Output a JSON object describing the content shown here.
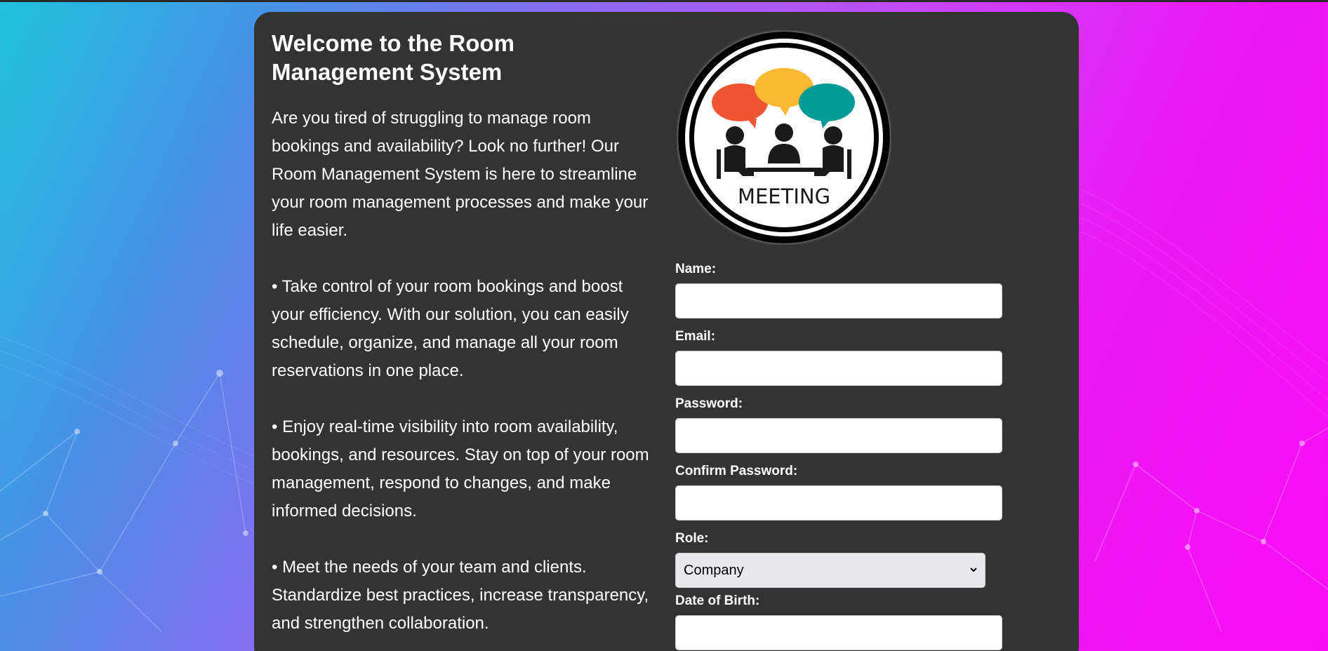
{
  "intro": {
    "title": "Welcome to the Room Management System",
    "paragraphs": [
      "Are you tired of struggling to manage room bookings and availability? Look no further! Our Room Management System is here to streamline your room management processes and make your life easier.",
      "• Take control of your room bookings and boost your efficiency. With our solution, you can easily schedule, organize, and manage all your room reservations in one place.",
      "• Enjoy real-time visibility into room availability, bookings, and resources. Stay on top of your room management, respond to changes, and make informed decisions.",
      "• Meet the needs of your team and clients. Standardize best practices, increase transparency, and strengthen collaboration."
    ]
  },
  "logo": {
    "text": "MEETING",
    "bubble_colors": [
      "#f05532",
      "#fbb933",
      "#009b94"
    ]
  },
  "form": {
    "name_label": "Name:",
    "name_value": "",
    "email_label": "Email:",
    "email_value": "",
    "password_label": "Password:",
    "password_value": "",
    "confirm_password_label": "Confirm Password:",
    "confirm_password_value": "",
    "role_label": "Role:",
    "role_selected": "Company",
    "dob_label": "Date of Birth:",
    "dob_value": ""
  },
  "colors": {
    "card_bg": "#333333",
    "text": "#ffffff"
  }
}
